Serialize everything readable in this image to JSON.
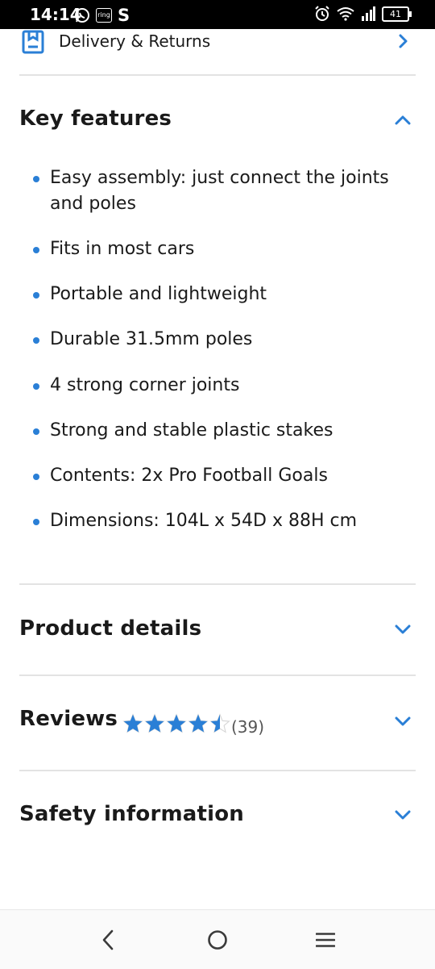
{
  "status_bar": {
    "time": "14:14",
    "ring_label": "ring",
    "s_label": "S",
    "battery": "41"
  },
  "delivery": {
    "label": "Delivery & Returns"
  },
  "key_features": {
    "title": "Key features",
    "items": [
      "Easy assembly: just connect the joints and poles",
      "Fits in most cars",
      "Portable and lightweight",
      "Durable 31.5mm poles",
      "4 strong corner joints",
      "Strong and stable plastic stakes",
      "Contents: 2x Pro Football Goals",
      "Dimensions: 104L x 54D x 88H cm"
    ]
  },
  "product_details": {
    "title": "Product details"
  },
  "reviews": {
    "title": "Reviews",
    "rating": 4.5,
    "count": "(39)"
  },
  "safety": {
    "title": "Safety information"
  },
  "colors": {
    "accent": "#2a7fd6",
    "star": "#2a7fd6",
    "divider": "#e3e3e3"
  },
  "icons": {
    "delivery": "box-icon",
    "chevron_right": "chevron-right-icon",
    "chevron_up": "chevron-up-icon",
    "chevron_down": "chevron-down-icon",
    "back": "back-icon",
    "home": "home-icon",
    "menu": "menu-icon"
  }
}
